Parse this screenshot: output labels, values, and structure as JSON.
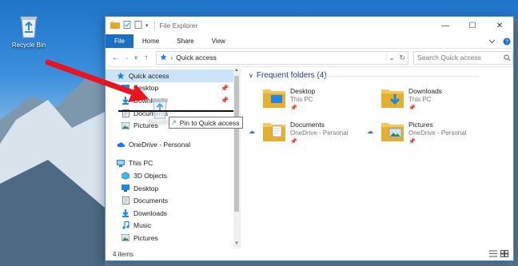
{
  "desktop": {
    "recycle_bin_label": "Recycle Bin"
  },
  "window": {
    "title": "File Explorer",
    "ribbon_tabs": [
      "File",
      "Home",
      "Share",
      "View"
    ],
    "address_crumb": "Quick access",
    "search_placeholder": "Search Quick access"
  },
  "nav": {
    "quick_access": "Quick access",
    "qa_items": [
      "Desktop",
      "Downloads",
      "Documents",
      "Pictures"
    ],
    "onedrive": "OneDrive - Personal",
    "this_pc": "This PC",
    "pc_items": [
      "3D Objects",
      "Desktop",
      "Documents",
      "Downloads",
      "Music",
      "Pictures"
    ]
  },
  "content": {
    "section_title": "Frequent folders (4)",
    "folders": [
      {
        "name": "Desktop",
        "location": "This PC"
      },
      {
        "name": "Downloads",
        "location": "This PC"
      },
      {
        "name": "Documents",
        "location": "OneDrive - Personal"
      },
      {
        "name": "Pictures",
        "location": "OneDrive - Personal"
      }
    ]
  },
  "drag": {
    "ghost_label": "Recycle Bin",
    "tooltip": "Pin to Quick access"
  },
  "status": {
    "items": "4 items"
  },
  "colors": {
    "accent": "#1a6fc2",
    "selection": "#cce4f7",
    "arrow": "#e8141f"
  }
}
